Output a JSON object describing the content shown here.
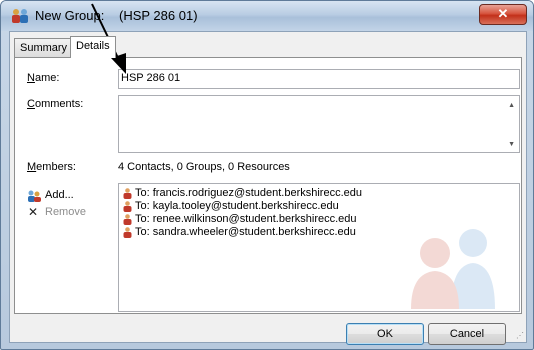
{
  "window": {
    "title_prefix": "New Group:",
    "title_name": "(HSP 286 01)",
    "close_glyph": "✕"
  },
  "tabs": [
    {
      "label": "Summary",
      "selected": false
    },
    {
      "label": "Details",
      "selected": true
    }
  ],
  "form": {
    "name_label_key": "N",
    "name_label_rest": "ame:",
    "name_value": "HSP 286 01",
    "comments_label_key": "C",
    "comments_label_rest": "omments:",
    "comments_value": "",
    "members_label_key": "M",
    "members_label_rest": "embers:",
    "members_summary": "4 Contacts, 0 Groups, 0 Resources"
  },
  "actions": {
    "add_label": "Add...",
    "remove_label": "Remove"
  },
  "members": [
    "To: francis.rodriguez@student.berkshirecc.edu",
    "To: kayla.tooley@student.berkshirecc.edu",
    "To: renee.wilkinson@student.berkshirecc.edu",
    "To: sandra.wheeler@student.berkshirecc.edu"
  ],
  "buttons": {
    "ok": "OK",
    "cancel": "Cancel"
  },
  "icons": {
    "app": "group-icon",
    "member": "person-icon",
    "add": "add-member-icon",
    "remove": "remove-x-icon"
  },
  "colors": {
    "close_button": "#c2301a",
    "title_bar": "#b9cde3",
    "member_icon": "#c0392b"
  }
}
